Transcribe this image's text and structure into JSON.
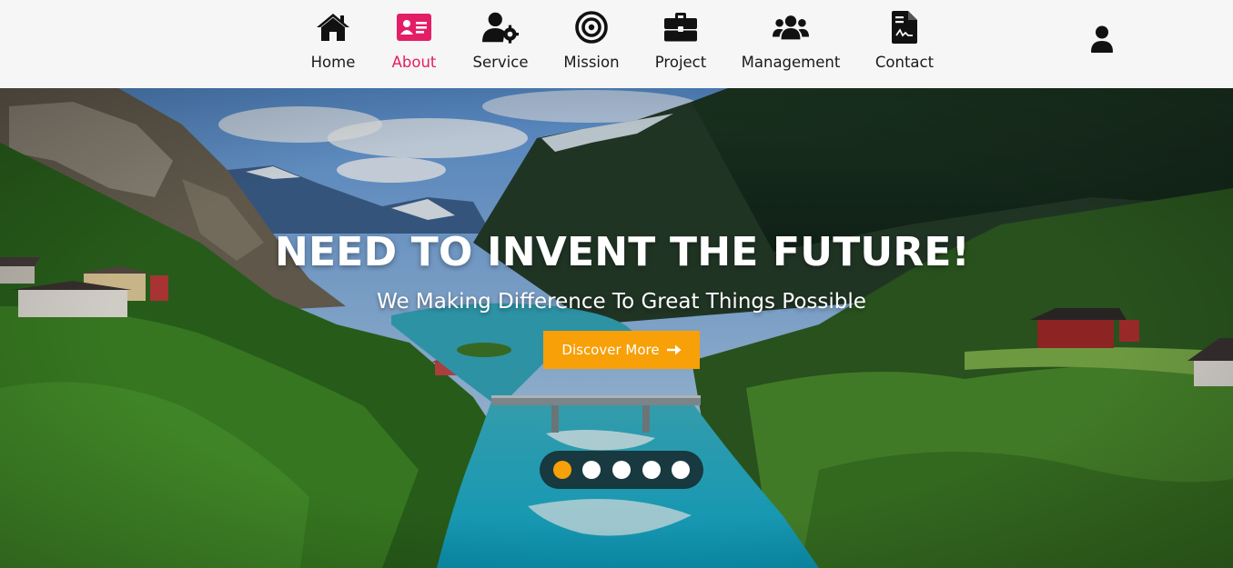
{
  "nav": {
    "items": [
      {
        "label": "Home",
        "icon": "home-icon",
        "active": false
      },
      {
        "label": "About",
        "icon": "id-card-icon",
        "active": true
      },
      {
        "label": "Service",
        "icon": "user-gear-icon",
        "active": false
      },
      {
        "label": "Mission",
        "icon": "target-icon",
        "active": false
      },
      {
        "label": "Project",
        "icon": "briefcase-icon",
        "active": false
      },
      {
        "label": "Management",
        "icon": "users-icon",
        "active": false
      },
      {
        "label": "Contact",
        "icon": "file-contract-icon",
        "active": false
      }
    ],
    "user_icon": "user-icon"
  },
  "hero": {
    "title": "NEED TO INVENT THE FUTURE!",
    "subtitle": "We Making Difference To Great Things Possible",
    "cta_label": "Discover More",
    "cta_icon": "arrow-right-icon",
    "slides_count": 5,
    "active_slide": 1
  },
  "colors": {
    "accent_pink": "#e31e66",
    "accent_orange": "#f7a008",
    "nav_bg": "#f6f6f6"
  }
}
